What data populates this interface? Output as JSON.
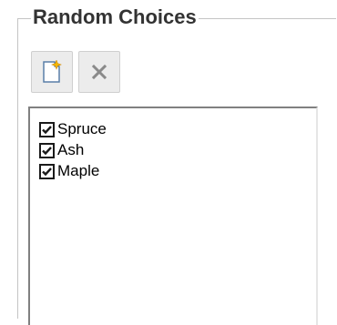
{
  "groupbox": {
    "title": "Random Choices"
  },
  "toolbar": {
    "new_icon": "new-document-icon",
    "delete_icon": "delete-x-icon"
  },
  "list": {
    "items": [
      {
        "label": "Spruce",
        "checked": true
      },
      {
        "label": "Ash",
        "checked": true
      },
      {
        "label": "Maple",
        "checked": true
      }
    ]
  },
  "colors": {
    "new_icon_star": "#f5b800",
    "delete_icon": "#8a8a8a",
    "checkmark": "#1a1a1a"
  }
}
